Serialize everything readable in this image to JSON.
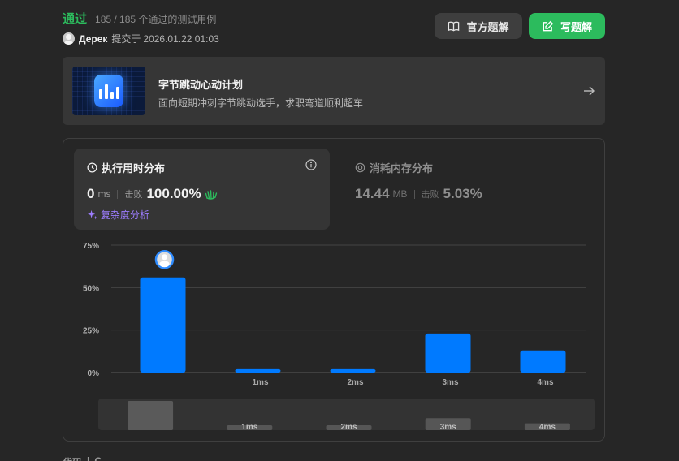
{
  "header": {
    "status": "通过",
    "testcases": "185 / 185 个通过的测试用例",
    "username": "Дерек",
    "submit_label": "提交于",
    "submit_time": "2026.01.22 01:03"
  },
  "buttons": {
    "official": "官方题解",
    "write": "写题解"
  },
  "banner": {
    "title": "字节跳动心动计划",
    "subtitle": "面向短期冲刺字节跳动选手，求职弯道顺利超车"
  },
  "runtime": {
    "title": "执行用时分布",
    "value": "0",
    "unit": "ms",
    "beat_label": "击败",
    "beat_pct": "100.00%",
    "complexity_link": "复杂度分析"
  },
  "memory": {
    "title": "消耗内存分布",
    "value": "14.44",
    "unit": "MB",
    "beat_label": "击败",
    "beat_pct": "5.03%"
  },
  "colors": {
    "accent_green": "#2cbb5d",
    "bar_blue": "#007aff",
    "complexity_purple": "#9d7dff"
  },
  "chart_data": {
    "type": "bar",
    "categories": [
      "",
      "1ms",
      "2ms",
      "3ms",
      "4ms"
    ],
    "values": [
      56,
      2,
      2,
      23,
      13
    ],
    "ylim": [
      0,
      75
    ],
    "yticks": [
      "0%",
      "25%",
      "50%",
      "75%"
    ],
    "ytick_values": [
      0,
      25,
      50,
      75
    ],
    "grid": true,
    "highlight_index": 0,
    "overview_labels": [
      "",
      "1ms",
      "2ms",
      "3ms",
      "4ms"
    ]
  },
  "footer": {
    "label": "代码",
    "language": "C"
  }
}
